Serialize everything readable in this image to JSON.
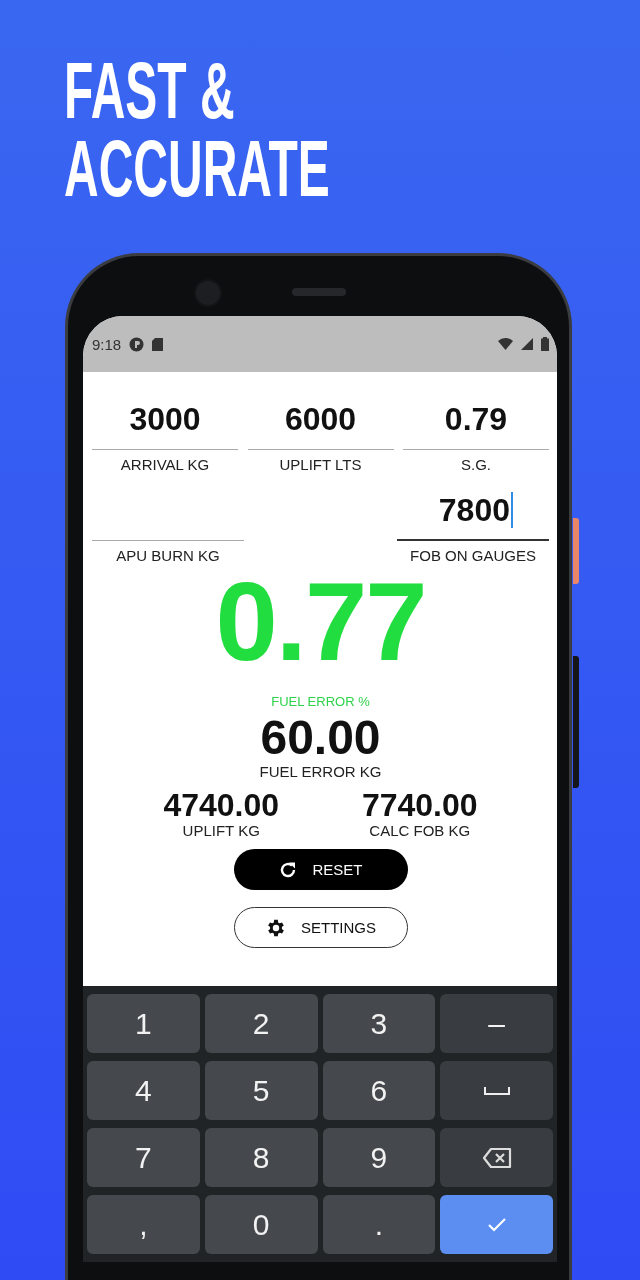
{
  "headline": [
    "FAST &",
    "ACCURATE"
  ],
  "status_bar": {
    "time": "9:18"
  },
  "inputs_top": [
    {
      "value": "3000",
      "label": "ARRIVAL KG",
      "focused": false
    },
    {
      "value": "6000",
      "label": "UPLIFT LTS",
      "focused": false
    },
    {
      "value": "0.79",
      "label": "S.G.",
      "focused": false
    }
  ],
  "inputs_bottom": [
    {
      "label": "APU BURN KG",
      "focused": false
    },
    {
      "value": "7800",
      "label": "FOB ON GAUGES",
      "focused": true
    }
  ],
  "fuel_error_percent": {
    "value": "0.77",
    "label": "FUEL ERROR %"
  },
  "fuel_error_kg": {
    "value": "60.00",
    "label": "FUEL ERROR KG"
  },
  "totals": [
    {
      "value": "4740.00",
      "label": "UPLIFT KG"
    },
    {
      "value": "7740.00",
      "label": "CALC FOB KG"
    }
  ],
  "buttons": [
    {
      "kind": "reset",
      "label": "RESET"
    },
    {
      "kind": "settings",
      "label": "SETTINGS"
    }
  ],
  "keyboard": [
    {
      "kind": "char",
      "label": "1"
    },
    {
      "kind": "char",
      "label": "2"
    },
    {
      "kind": "char",
      "label": "3"
    },
    {
      "kind": "function",
      "label": "–"
    },
    {
      "kind": "char",
      "label": "4"
    },
    {
      "kind": "char",
      "label": "5"
    },
    {
      "kind": "char",
      "label": "6"
    },
    {
      "kind": "space"
    },
    {
      "kind": "char",
      "label": "7"
    },
    {
      "kind": "char",
      "label": "8"
    },
    {
      "kind": "char",
      "label": "9"
    },
    {
      "kind": "backspace"
    },
    {
      "kind": "char",
      "label": ","
    },
    {
      "kind": "char",
      "label": "0"
    },
    {
      "kind": "char",
      "label": "."
    },
    {
      "kind": "done"
    }
  ]
}
